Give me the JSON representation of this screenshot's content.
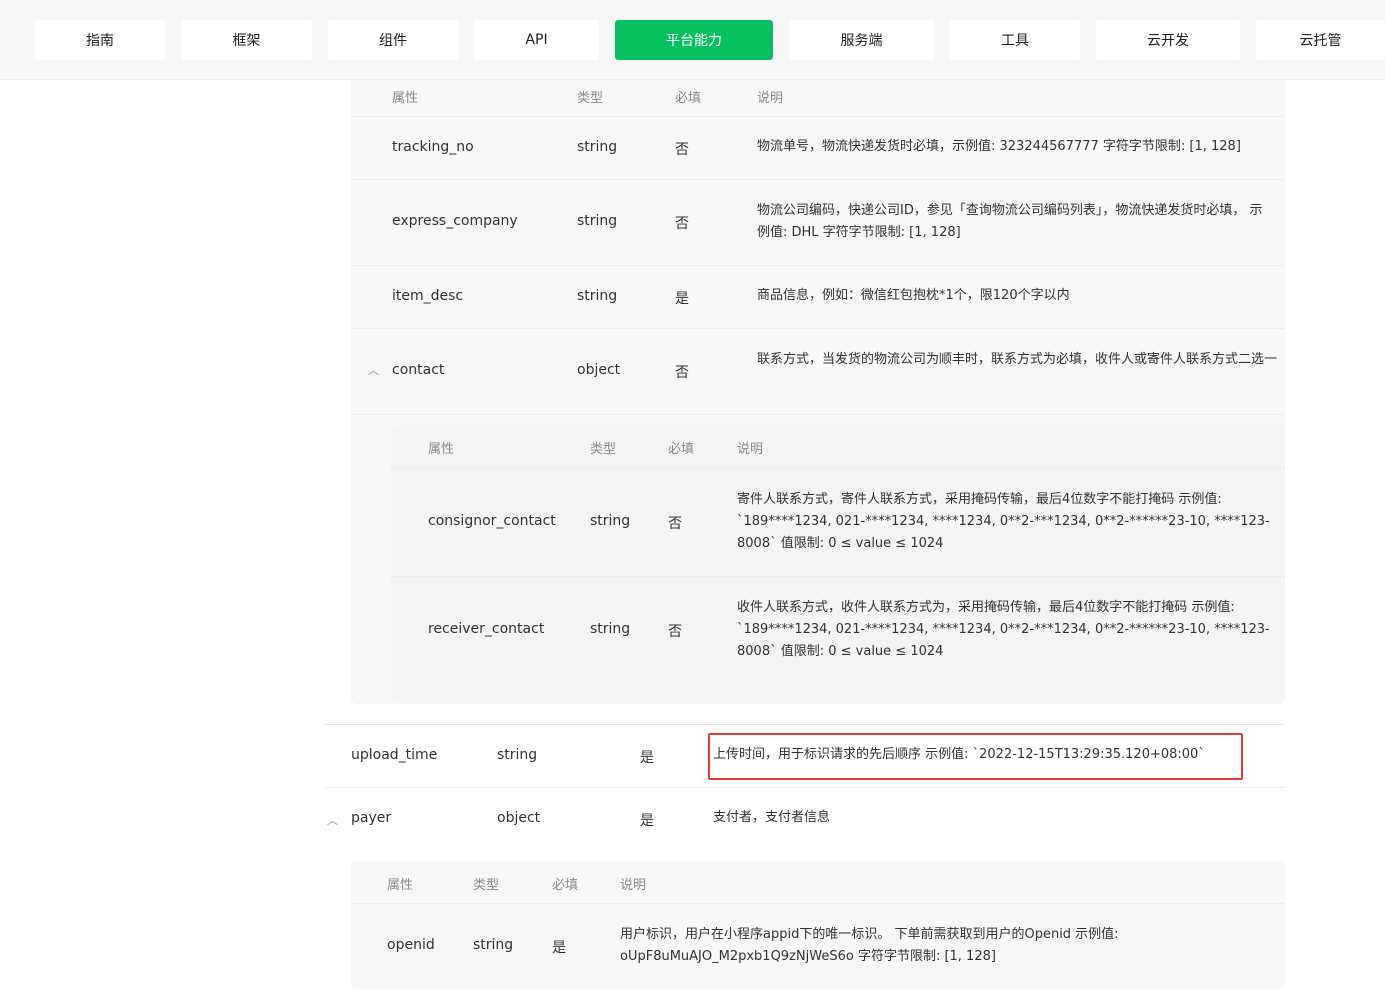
{
  "nav": {
    "tabs": [
      {
        "label": "指南"
      },
      {
        "label": "框架"
      },
      {
        "label": "组件"
      },
      {
        "label": "API"
      },
      {
        "label": "平台能力",
        "active": true
      },
      {
        "label": "服务端"
      },
      {
        "label": "工具"
      },
      {
        "label": "云开发"
      },
      {
        "label": "云托管"
      }
    ],
    "accent_color": "#07c160"
  },
  "headers": {
    "attr": "属性",
    "type": "类型",
    "required": "必填",
    "desc": "说明"
  },
  "shipping_fields": [
    {
      "name": "tracking_no",
      "type": "string",
      "required": "否",
      "desc": "物流单号，物流快递发货时必填，示例值: 323244567777 字符字节限制: [1, 128]"
    },
    {
      "name": "express_company",
      "type": "string",
      "required": "否",
      "desc": "物流公司编码，快递公司ID，参见「查询物流公司编码列表」，物流快递发货时必填， 示例值: DHL 字符字节限制: [1, 128]"
    },
    {
      "name": "item_desc",
      "type": "string",
      "required": "是",
      "desc": "商品信息，例如：微信红包抱枕*1个，限120个字以内"
    },
    {
      "name": "contact",
      "type": "object",
      "required": "否",
      "desc": "联系方式，当发货的物流公司为顺丰时，联系方式为必填，收件人或寄件人联系方式二选一",
      "expanded": true
    }
  ],
  "contact_fields": [
    {
      "name": "consignor_contact",
      "type": "string",
      "required": "否",
      "desc": "寄件人联系方式，寄件人联系方式，采用掩码传输，最后4位数字不能打掩码 示例值: `189****1234, 021-****1234, ****1234, 0**2-***1234, 0**2-******23-10, ****123-8008` 值限制: 0 ≤ value ≤ 1024"
    },
    {
      "name": "receiver_contact",
      "type": "string",
      "required": "否",
      "desc": "收件人联系方式，收件人联系方式为，采用掩码传输，最后4位数字不能打掩码 示例值: `189****1234, 021-****1234, ****1234, 0**2-***1234, 0**2-******23-10, ****123-8008` 值限制: 0 ≤ value ≤ 1024"
    }
  ],
  "top_fields": [
    {
      "name": "upload_time",
      "type": "string",
      "required": "是",
      "desc": "上传时间，用于标识请求的先后顺序 示例值: `2022-12-15T13:29:35.120+08:00`",
      "highlighted": true
    },
    {
      "name": "payer",
      "type": "object",
      "required": "是",
      "desc": "支付者，支付者信息",
      "expanded": true
    }
  ],
  "payer_fields": [
    {
      "name": "openid",
      "type": "string",
      "required": "是",
      "desc": "用户标识，用户在小程序appid下的唯一标识。 下单前需获取到用户的Openid 示例值: oUpF8uMuAJO_M2pxb1Q9zNjWeS6o 字符字节限制: [1, 128]"
    }
  ],
  "icons": {
    "collapse": "chevron-up-icon"
  },
  "highlight_color": "#e53935"
}
